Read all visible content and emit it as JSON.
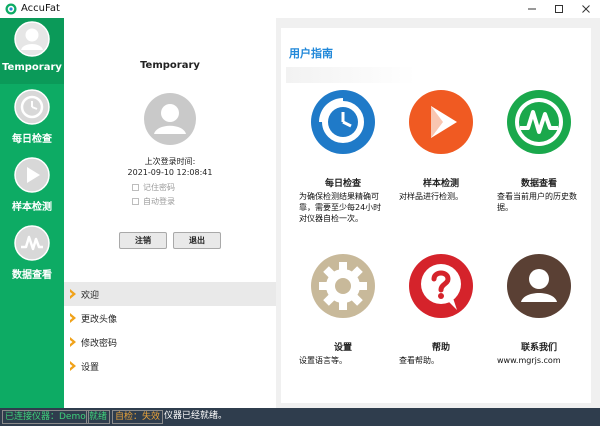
{
  "window": {
    "title": "AccuFat",
    "minimize_icon": "minimize-icon",
    "maximize_icon": "maximize-icon",
    "close_icon": "close-icon"
  },
  "nav": {
    "items": [
      {
        "label": "Temporary",
        "icon": "user-icon",
        "active": true
      },
      {
        "label": "每日检查",
        "icon": "clock-icon",
        "active": false
      },
      {
        "label": "样本检测",
        "icon": "play-icon",
        "active": false
      },
      {
        "label": "数据查看",
        "icon": "chart-icon",
        "active": false
      }
    ]
  },
  "profile": {
    "name": "Temporary",
    "last_login_label": "上次登录时间:",
    "last_login_time": "2021-09-10 12:08:41",
    "remember_password": "记住密码",
    "auto_login": "自动登录",
    "logout_button": "注销",
    "exit_button": "退出"
  },
  "menu": {
    "items": [
      {
        "label": "欢迎",
        "active": true
      },
      {
        "label": "更改头像",
        "active": false
      },
      {
        "label": "修改密码",
        "active": false
      },
      {
        "label": "设置",
        "active": false
      }
    ]
  },
  "guide": {
    "title": "用户指南",
    "cards": [
      {
        "title": "每日检查",
        "desc": "为确保检测结果精确可靠，需要至少每24小时对仪器自检一次。",
        "icon": "clock-icon"
      },
      {
        "title": "样本检测",
        "desc": "对样品进行检测。",
        "icon": "play-icon"
      },
      {
        "title": "数据查看",
        "desc": "查看当前用户的历史数据。",
        "icon": "chart-icon"
      },
      {
        "title": "设置",
        "desc": "设置语言等。",
        "icon": "gear-icon"
      },
      {
        "title": "帮助",
        "desc": "查看帮助。",
        "icon": "question-icon"
      },
      {
        "title": "联系我们",
        "desc": "www.mgrjs.com",
        "icon": "contact-icon"
      }
    ]
  },
  "status": {
    "connected": "已连接仪器：Demo",
    "ready": "就绪",
    "self_check": "自检：失效",
    "message": "仪器已经就绪。"
  },
  "colors": {
    "nav_green": "#0dab64",
    "blue": "#1f7ac8",
    "orange": "#f05a22",
    "green": "#1aa84c",
    "tan": "#c8b99a",
    "red": "#d5232b",
    "brown": "#5a4034",
    "status_bg": "#2f3d4d"
  }
}
